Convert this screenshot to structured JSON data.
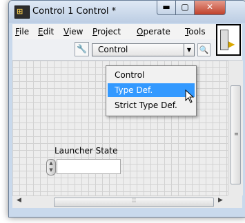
{
  "window": {
    "title": "Control 1 Control *",
    "minimize_icon": "minimize-icon",
    "maximize_icon": "maximize-icon",
    "close_icon": "close-icon",
    "minimize_glyph": "▬",
    "maximize_glyph": "▢",
    "close_glyph": "✕",
    "app_icon_glyph": "⊞"
  },
  "menubar": {
    "items": [
      {
        "label": "File",
        "key": "F",
        "rest": "ile"
      },
      {
        "label": "Edit",
        "key": "E",
        "rest": "dit"
      },
      {
        "label": "View",
        "key": "V",
        "rest": "iew"
      },
      {
        "label": "Project",
        "key": "P",
        "rest": "roject"
      },
      {
        "label": "Operate",
        "key": "O",
        "rest": "perate"
      },
      {
        "label": "Tools",
        "key": "T",
        "rest": "ools"
      }
    ]
  },
  "toolbar": {
    "control_type_value": "Control",
    "wrench_glyph": "🔧",
    "dropdown_arrow_glyph": "▼",
    "magnifier_glyph": "🔍"
  },
  "dropdown": {
    "options": [
      "Control",
      "Type Def.",
      "Strict Type Def."
    ],
    "highlighted": "Type Def."
  },
  "panel": {
    "control_label": "Launcher State",
    "control_value": ""
  },
  "colors": {
    "highlight": "#3399ff",
    "close_button": "#c0422c",
    "titlebar": "#c9d9ec"
  }
}
